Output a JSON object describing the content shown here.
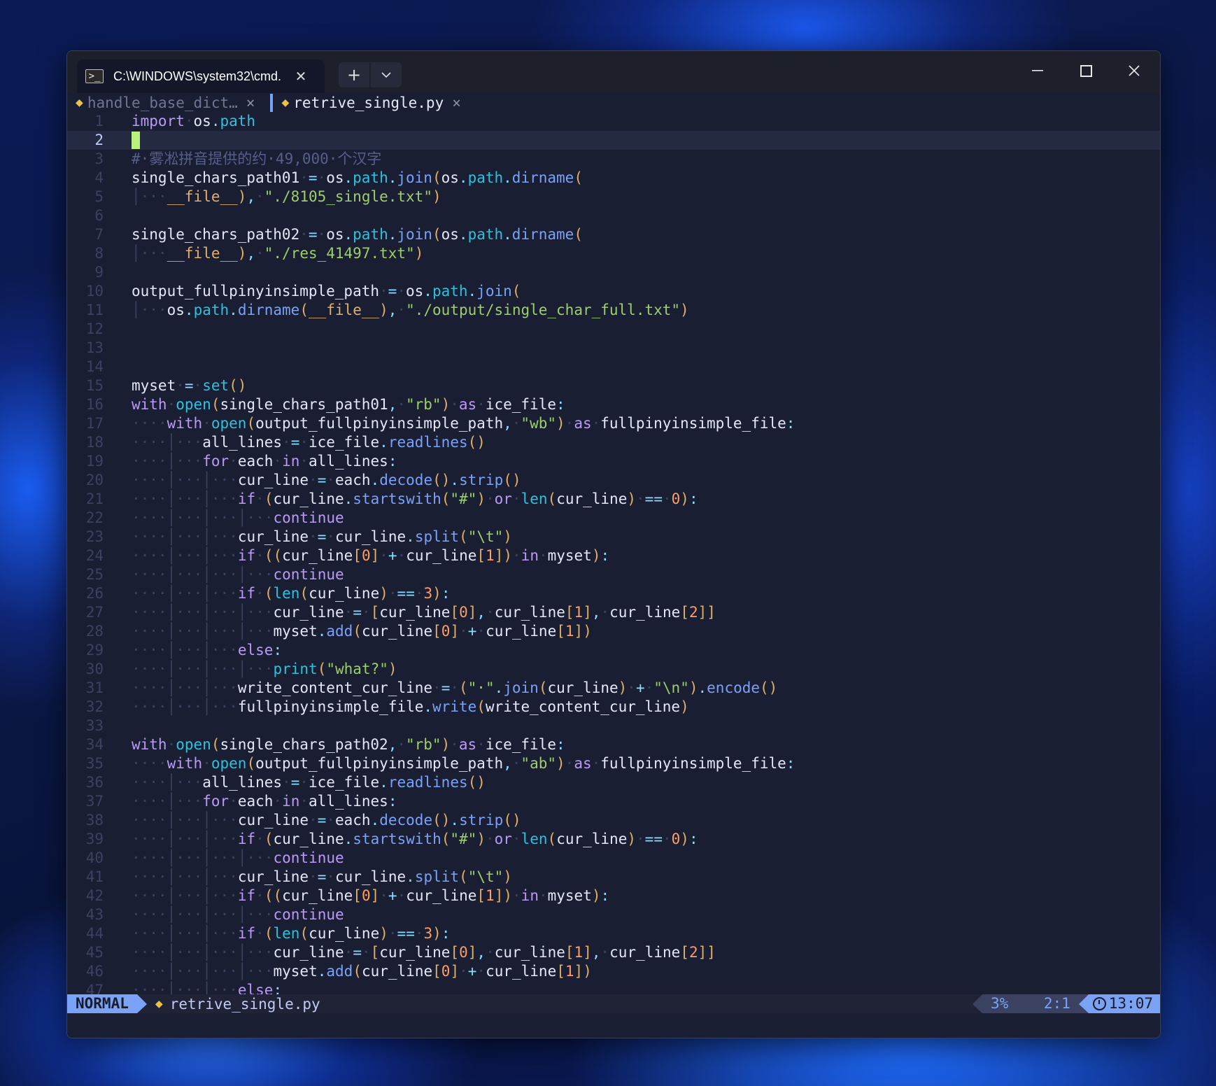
{
  "window": {
    "tab_title": "C:\\WINDOWS\\system32\\cmd.",
    "tab_icon": "terminal-icon",
    "new_tab": "+",
    "dropdown": "⌄",
    "minimize": "—",
    "close": "✕"
  },
  "bufferline": {
    "buffers": [
      {
        "name": "handle_base_dict…",
        "close": "×",
        "active": false
      },
      {
        "name": "retrive_single.py",
        "close": "×",
        "active": true
      }
    ]
  },
  "editor": {
    "lines": [
      "import·os.path",
      "",
      "#·雾凇拼音提供的约·49,000·个汉字",
      "single_chars_path01·=·os.path.join(os.path.dirname(",
      "│···__file__),·\"./8105_single.txt\")",
      "",
      "single_chars_path02·=·os.path.join(os.path.dirname(",
      "│···__file__),·\"./res_41497.txt\")",
      "",
      "output_fullpinyinsimple_path·=·os.path.join(",
      "│···os.path.dirname(__file__),·\"./output/single_char_full.txt\")",
      "",
      "",
      "",
      "myset·=·set()",
      "with·open(single_chars_path01,·\"rb\")·as·ice_file:",
      "····with·open(output_fullpinyinsimple_path,·\"wb\")·as·fullpinyinsimple_file:",
      "····│···all_lines·=·ice_file.readlines()",
      "····│···for·each·in·all_lines:",
      "····│···│···cur_line·=·each.decode().strip()",
      "····│···│···if·(cur_line.startswith(\"#\")·or·len(cur_line)·==·0):",
      "····│···│···│···continue",
      "····│···│···cur_line·=·cur_line.split(\"\\t\")",
      "····│···│···if·((cur_line[0]·+·cur_line[1])·in·myset):",
      "····│···│···│···continue",
      "····│···│···if·(len(cur_line)·==·3):",
      "····│···│···│···cur_line·=·[cur_line[0],·cur_line[1],·cur_line[2]]",
      "····│···│···│···myset.add(cur_line[0]·+·cur_line[1])",
      "····│···│···else:",
      "····│···│···│···print(\"what?\")",
      "····│···│···write_content_cur_line·=·(\"·\".join(cur_line)·+·\"\\n\").encode()",
      "····│···│···fullpinyinsimple_file.write(write_content_cur_line)",
      "",
      "with·open(single_chars_path02,·\"rb\")·as·ice_file:",
      "····with·open(output_fullpinyinsimple_path,·\"ab\")·as·fullpinyinsimple_file:",
      "····│···all_lines·=·ice_file.readlines()",
      "····│···for·each·in·all_lines:",
      "····│···│···cur_line·=·each.decode().strip()",
      "····│···│···if·(cur_line.startswith(\"#\")·or·len(cur_line)·==·0):",
      "····│···│···│···continue",
      "····│···│···cur_line·=·cur_line.split(\"\\t\")",
      "····│···│···if·((cur_line[0]·+·cur_line[1])·in·myset):",
      "····│···│···│···continue",
      "····│···│···if·(len(cur_line)·==·3):",
      "····│···│···│···cur_line·=·[cur_line[0],·cur_line[1],·cur_line[2]]",
      "····│···│···│···myset.add(cur_line[0]·+·cur_line[1])",
      "····│···│···else:"
    ],
    "cursor_line": 2
  },
  "statusline": {
    "mode": "NORMAL",
    "file": "retrive_single.py",
    "percent": "3%",
    "position": "2:1",
    "time": "13:07"
  },
  "colors": {
    "accent": "#7aa2f7",
    "keyword": "#bb9af7",
    "string": "#9ece6a",
    "number": "#ff9e64",
    "builtin": "#2ac3de",
    "cursor": "#b9f27c"
  }
}
